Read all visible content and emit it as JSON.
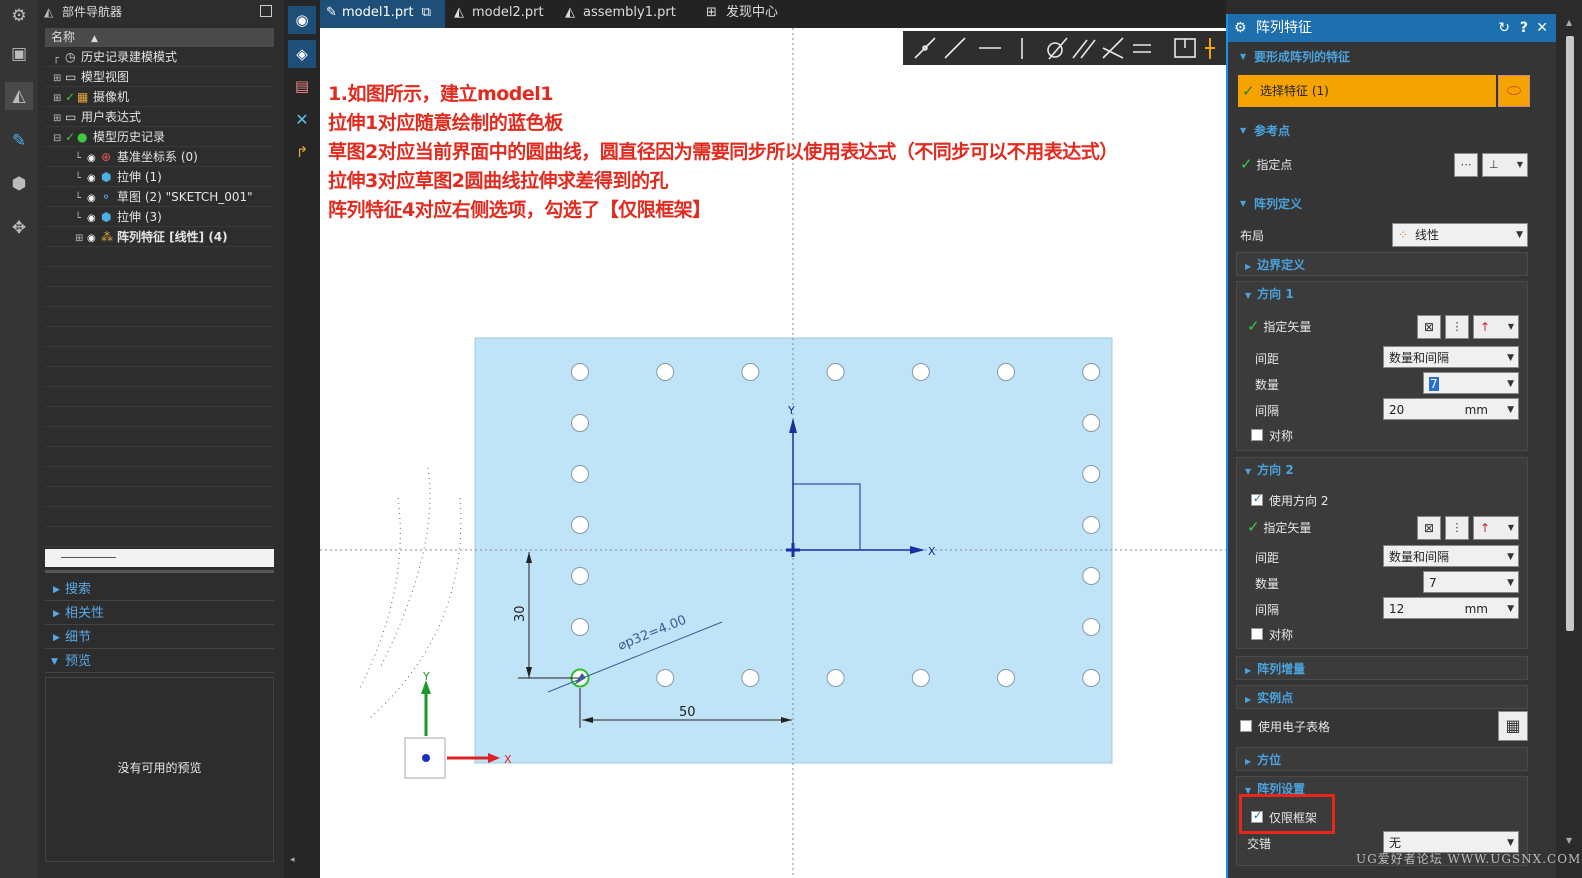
{
  "navigator": {
    "title": "部件导航器",
    "header": "名称",
    "tree": [
      {
        "label": "历史记录建模模式",
        "indent": 0
      },
      {
        "label": "模型视图",
        "indent": 0
      },
      {
        "label": "摄像机",
        "indent": 0
      },
      {
        "label": "用户表达式",
        "indent": 0
      },
      {
        "label": "模型历史记录",
        "indent": 0
      },
      {
        "label": "基准坐标系 (0)",
        "indent": 1
      },
      {
        "label": "拉伸 (1)",
        "indent": 1
      },
      {
        "label": "草图 (2) \"SKETCH_001\"",
        "indent": 1
      },
      {
        "label": "拉伸 (3)",
        "indent": 1
      },
      {
        "label": "阵列特征 [线性] (4)",
        "indent": 1
      }
    ],
    "sections": [
      "搜索",
      "相关性",
      "细节",
      "预览"
    ],
    "preview_empty": "没有可用的预览"
  },
  "tabs": [
    "model1.prt",
    "model2.prt",
    "assembly1.prt",
    "发现中心"
  ],
  "annotation": [
    "1.如图所示，建立model1",
    "拉伸1对应随意绘制的蓝色板",
    "草图2对应当前界面中的圆曲线，圆直径因为需要同步所以使用表达式（不同步可以不用表达式）",
    "拉伸3对应草图2圆曲线拉伸求差得到的孔",
    "阵列特征4对应右侧选项，勾选了【仅限框架】"
  ],
  "sketch": {
    "dim_vertical": "30",
    "dim_horizontal": "50",
    "dim_diameter": "⌀p32=4.00",
    "axis_x": "X",
    "axis_y": "Y",
    "triad_x": "X",
    "triad_y": "Y",
    "grid_cols": 7,
    "grid_rows": 7
  },
  "dialog": {
    "title": "阵列特征",
    "sec_feature": "要形成阵列的特征",
    "select_feature": "选择特征 (1)",
    "sec_ref": "参考点",
    "specify_point": "指定点",
    "sec_def": "阵列定义",
    "layout_label": "布局",
    "layout_value": "线性",
    "sec_boundary": "边界定义",
    "sec_dir1": "方向 1",
    "dir1_vector": "指定矢量",
    "dir1_spacing_label": "间距",
    "dir1_spacing_value": "数量和间隔",
    "dir1_count_label": "数量",
    "dir1_count_value": "7",
    "dir1_pitch_label": "间隔",
    "dir1_pitch_value": "20",
    "dir1_pitch_unit": "mm",
    "dir1_sym": "对称",
    "sec_dir2": "方向 2",
    "use_dir2": "使用方向 2",
    "dir2_vector": "指定矢量",
    "dir2_spacing_label": "间距",
    "dir2_spacing_value": "数量和间隔",
    "dir2_count_label": "数量",
    "dir2_count_value": "7",
    "dir2_pitch_label": "间隔",
    "dir2_pitch_value": "12",
    "dir2_pitch_unit": "mm",
    "dir2_sym": "对称",
    "sec_increment": "阵列增量",
    "sec_instance": "实例点",
    "use_spreadsheet": "使用电子表格",
    "sec_orient": "方位",
    "sec_settings": "阵列设置",
    "frame_only": "仅限框架",
    "stagger_label": "交错",
    "stagger_value": "无"
  },
  "watermark": "UG爱好者论坛 WWW.UGSNX.COM",
  "colors": {
    "plate": "#bfe3f7",
    "annotation": "#e22a1e",
    "dialog_title": "#1e6fae",
    "select_highlight": "#f5a300",
    "callout": "#e8261a"
  }
}
